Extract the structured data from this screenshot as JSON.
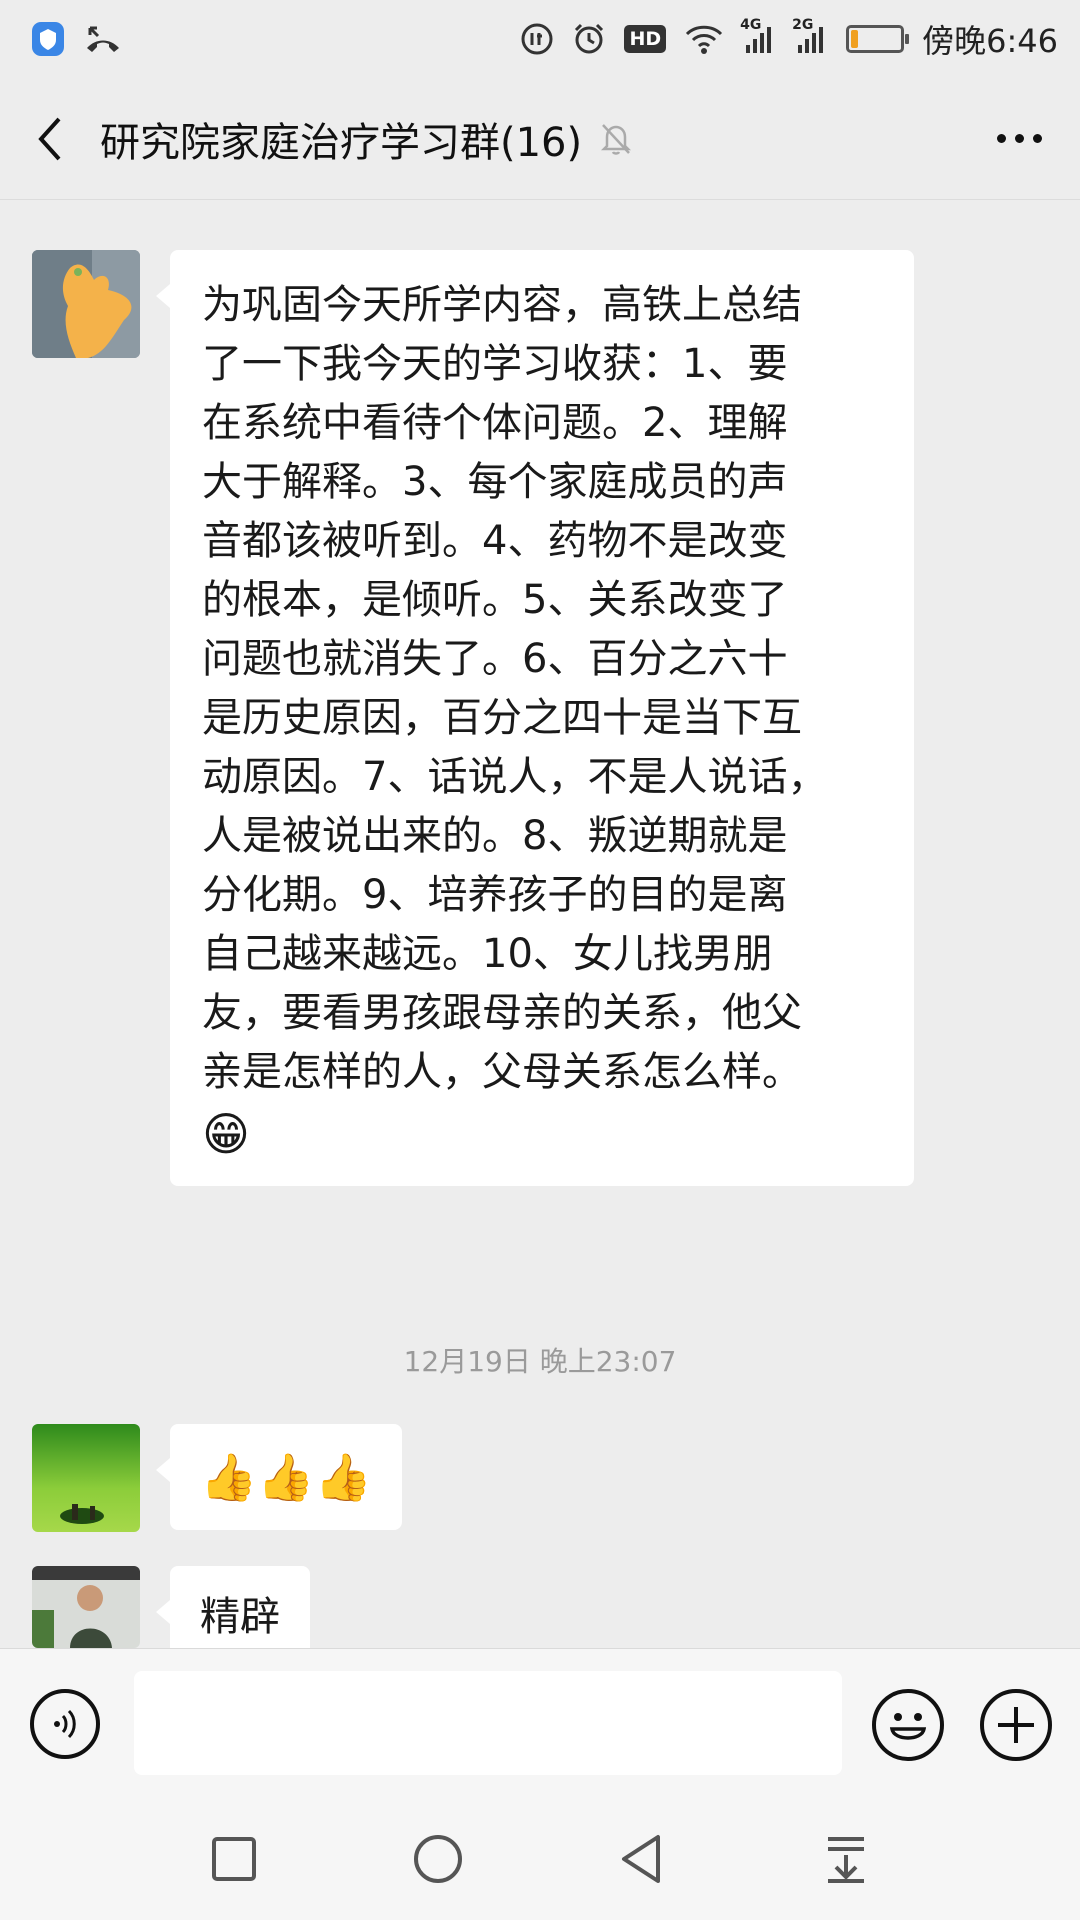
{
  "status_bar": {
    "time": "傍晚6:46",
    "network_1": "4G",
    "network_2": "2G",
    "hd_badge": "HD",
    "battery_level": 0.15,
    "icons": [
      "shield-icon",
      "missed-call-icon",
      "data-saver-icon",
      "alarm-icon",
      "hd-icon",
      "wifi-icon",
      "signal-icon",
      "signal-icon",
      "battery-icon"
    ]
  },
  "header": {
    "title": "研究院家庭治疗学习群(16)",
    "back_icon": "chevron-left-icon",
    "mute_icon": "bell-muted-icon",
    "more_icon": "more-horizontal-icon"
  },
  "messages": [
    {
      "lines": [
        "为巩固今天所学内容，高铁上总结",
        "了一下我今天的学习收获：1、要",
        "在系统中看待个体问题。2、理解",
        "大于解释。3、每个家庭成员的声",
        "音都该被听到。4、药物不是改变",
        "的根本，是倾听。5、关系改变了",
        "问题也就消失了。6、百分之六十",
        "是历史原因，百分之四十是当下互",
        "动原因。7、话说人，不是人说话，",
        "人是被说出来的。8、叛逆期就是",
        "分化期。9、培养孩子的目的是离",
        "自己越来越远。10、女儿找男朋",
        "友，要看男孩跟母亲的关系，他父",
        "亲是怎样的人，父母关系怎么样。"
      ],
      "emoji": "😁"
    },
    {
      "text": "👍👍👍"
    },
    {
      "text": "精辟"
    }
  ],
  "timestamp": "12月19日 晚上23:07",
  "input_bar": {
    "placeholder": "",
    "voice_icon": "voice-icon",
    "emoji_icon": "emoji-icon",
    "plus_icon": "plus-icon"
  },
  "nav_bar": {
    "icons": [
      "recents-square-icon",
      "home-circle-icon",
      "back-triangle-icon",
      "notification-pull-icon"
    ]
  }
}
